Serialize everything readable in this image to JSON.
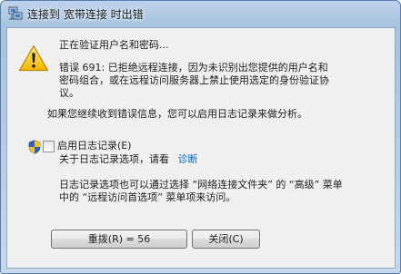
{
  "window": {
    "title": "连接到 宽带连接 时出错"
  },
  "message": {
    "status": "正在验证用户名和密码...",
    "error_line1": "错误 691: 已拒绝远程连接，因为未识别出您提供的用户名和",
    "error_line2": "密码组合，或在远程访问服务器上禁止使用选定的身份验证协",
    "error_line3": "议。",
    "continue_hint": "如果您继续收到错误信息，您可以启用日志记录来做分析。"
  },
  "logging": {
    "checkbox_label": "启用日志记录(E)",
    "checked": false,
    "about_prefix": "关于日志记录选项，请看",
    "diagnose_link": "诊断",
    "info_line1": "日志记录选项也可以通过选择 “网络连接文件夹” 的 “高级” 菜单",
    "info_line2": "中的 “远程访问首选项” 菜单项来访问。"
  },
  "buttons": {
    "redial": "重拨(R) = 56",
    "close": "关闭(C)"
  },
  "icons": {
    "title": "network-connection-icon",
    "warning": "warning-icon",
    "shield": "uac-shield-icon"
  },
  "colors": {
    "warning": "#f2c200",
    "link": "#0066cc"
  }
}
